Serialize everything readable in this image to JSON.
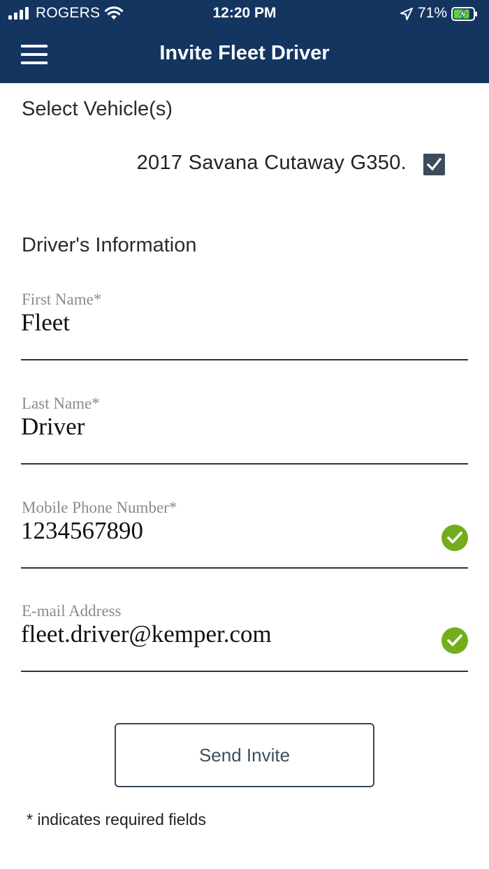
{
  "status_bar": {
    "carrier": "ROGERS",
    "time": "12:20 PM",
    "battery": "71%"
  },
  "nav": {
    "title": "Invite Fleet Driver",
    "menu_icon": "hamburger-menu-icon"
  },
  "vehicles": {
    "heading": "Select Vehicle(s)",
    "items": [
      {
        "label": "2017 Savana Cutaway G350.",
        "checked": true
      }
    ]
  },
  "driver": {
    "heading": "Driver's Information",
    "fields": {
      "first_name": {
        "label": "First Name*",
        "value": "Fleet"
      },
      "last_name": {
        "label": "Last Name*",
        "value": "Driver"
      },
      "phone": {
        "label": "Mobile Phone Number*",
        "value": "1234567890",
        "valid": true
      },
      "email": {
        "label": "E-mail Address",
        "value": "fleet.driver@kemper.com",
        "valid": true
      }
    }
  },
  "actions": {
    "send_label": "Send Invite"
  },
  "footnote": "* indicates required fields",
  "colors": {
    "header_bg": "#143560",
    "valid_green": "#73ad1e",
    "checkbox_bg": "#3d4b5c"
  }
}
